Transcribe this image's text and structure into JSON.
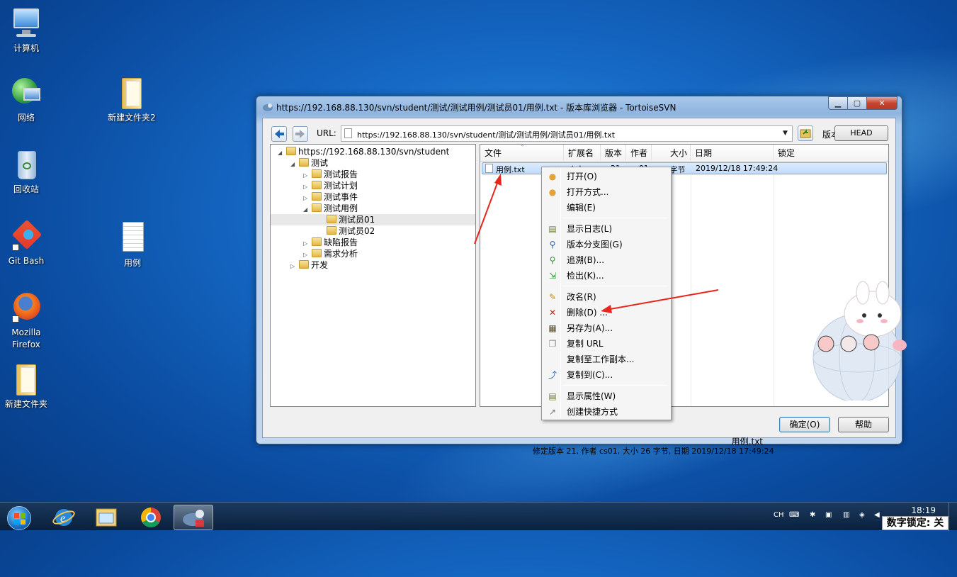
{
  "desktop": {
    "icons": [
      {
        "label": "计算机",
        "icon": "computer-icon"
      },
      {
        "label": "网络",
        "icon": "network-icon"
      },
      {
        "label": "新建文件夹2",
        "icon": "folder-icon"
      },
      {
        "label": "回收站",
        "icon": "recycle-bin-icon"
      },
      {
        "label": "Git Bash",
        "icon": "git-bash-icon"
      },
      {
        "label": "用例",
        "icon": "text-file-icon"
      },
      {
        "label": "Mozilla Firefox",
        "icon": "firefox-icon"
      },
      {
        "label": "新建文件夹",
        "icon": "folder-icon"
      }
    ]
  },
  "window": {
    "title": "https://192.168.88.130/svn/student/测试/测试用例/测试员01/用例.txt - 版本库浏览器 - TortoiseSVN",
    "url_label": "URL:",
    "url_value": "https://192.168.88.130/svn/student/测试/测试用例/测试员01/用例.txt",
    "revision_label": "版本:",
    "revision_button": "HEAD",
    "tree": [
      {
        "label": "https://192.168.88.130/svn/student",
        "expander": "◢"
      },
      {
        "label": "测试",
        "expander": "◢"
      },
      {
        "label": "测试报告",
        "expander": "▷"
      },
      {
        "label": "测试计划",
        "expander": "▷"
      },
      {
        "label": "测试事件",
        "expander": "▷"
      },
      {
        "label": "测试用例",
        "expander": "◢"
      },
      {
        "label": "测试员01",
        "expander": ""
      },
      {
        "label": "测试员02",
        "expander": ""
      },
      {
        "label": "缺陷报告",
        "expander": "▷"
      },
      {
        "label": "需求分析",
        "expander": "▷"
      },
      {
        "label": "开发",
        "expander": "▷"
      }
    ],
    "columns": [
      "文件",
      "扩展名",
      "版本",
      "作者",
      "大小",
      "日期",
      "锁定"
    ],
    "file_row": {
      "name": "用例.txt",
      "ext": ".txt",
      "revision": "21",
      "author": "cs01",
      "size": "26 字节",
      "date": "2019/12/18 17:49:24"
    },
    "status_filename": "用例.txt",
    "status_line": "修定版本 21, 作者 cs01, 大小 26 字节, 日期 2019/12/18 17:49:24",
    "ok_button": "确定(O)",
    "help_button": "帮助"
  },
  "context_menu": {
    "groups": [
      [
        {
          "label": "打开(O)",
          "icon": "open-icon"
        },
        {
          "label": "打开方式...",
          "icon": "open-with-icon"
        },
        {
          "label": "编辑(E)",
          "icon": ""
        }
      ],
      [
        {
          "label": "显示日志(L)",
          "icon": "log-icon"
        },
        {
          "label": "版本分支图(G)",
          "icon": "revision-graph-icon"
        },
        {
          "label": "追溯(B)...",
          "icon": "blame-icon"
        },
        {
          "label": "检出(K)...",
          "icon": "checkout-icon"
        }
      ],
      [
        {
          "label": "改名(R)",
          "icon": "rename-icon"
        },
        {
          "label": "删除(D) ...",
          "icon": "delete-icon"
        },
        {
          "label": "另存为(A)...",
          "icon": "save-as-icon"
        },
        {
          "label": "复制 URL",
          "icon": "copy-url-icon"
        },
        {
          "label": "复制至工作副本...",
          "icon": ""
        },
        {
          "label": "复制到(C)...",
          "icon": "copy-to-icon"
        }
      ],
      [
        {
          "label": "显示属性(W)",
          "icon": "properties-icon"
        },
        {
          "label": "创建快捷方式",
          "icon": "shortcut-icon"
        }
      ]
    ]
  },
  "taskbar": {
    "items": [
      "start-button",
      "ie-icon",
      "explorer-icon",
      "chrome-icon",
      "tortoisesvn-icon"
    ],
    "tray_lang": "CH",
    "clock_time": "18:19",
    "numlock_text": "数字锁定: 关"
  },
  "colors": {
    "accent": "#3399ff",
    "annotation_arrow": "#e8261c",
    "window_frame": "#a9c8ea"
  }
}
